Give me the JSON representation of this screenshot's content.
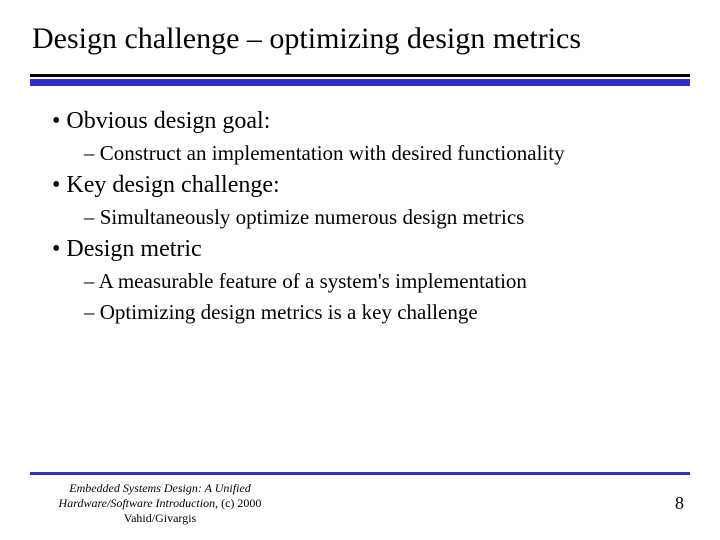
{
  "title": "Design challenge – optimizing design metrics",
  "bullets": {
    "b1": "Obvious design goal:",
    "b1a": "Construct an implementation with desired functionality",
    "b2": "Key design challenge:",
    "b2a": "Simultaneously optimize numerous design metrics",
    "b3": "Design metric",
    "b3a": "A measurable feature of a system's implementation",
    "b3b": "Optimizing design metrics is a key challenge"
  },
  "footer": {
    "line1": "Embedded Systems Design: A Unified",
    "line2_italic": "Hardware/Software Introduction,",
    "line2_plain": " (c) 2000 Vahid/Givargis"
  },
  "page_number": "8",
  "colors": {
    "accent_blue": "#2e31c8"
  }
}
